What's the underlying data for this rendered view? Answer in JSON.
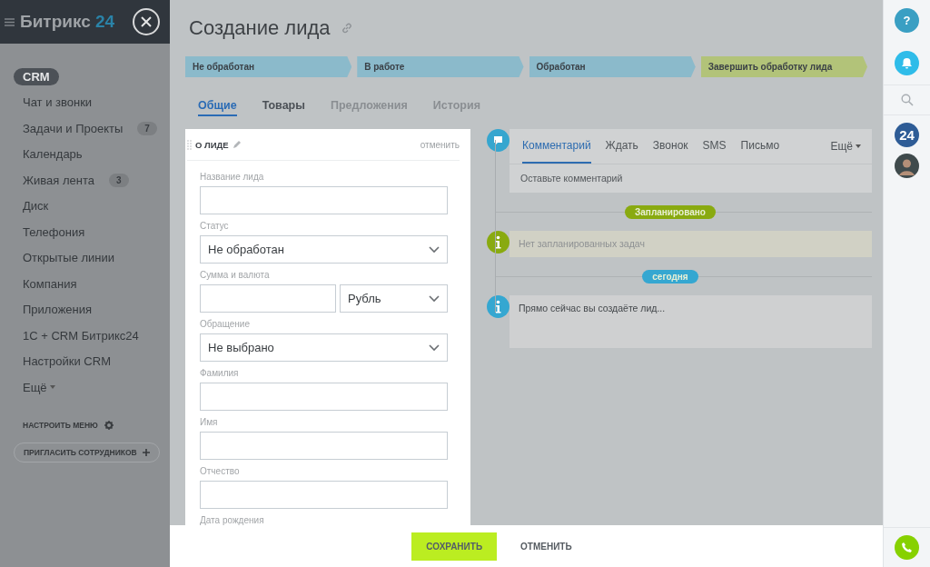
{
  "sidebar": {
    "logo": "Битрикс",
    "logo_accent": "24",
    "items": [
      {
        "label": "CRM",
        "selected": true
      },
      {
        "label": "Чат и звонки",
        "selected": false
      },
      {
        "label": "Задачи и Проекты",
        "counter": "7",
        "selected": false
      },
      {
        "label": "Календарь",
        "selected": false
      },
      {
        "label": "Живая лента",
        "counter": "3",
        "selected": false
      },
      {
        "label": "Диск",
        "selected": false
      },
      {
        "label": "Телефония",
        "selected": false
      },
      {
        "label": "Открытые линии",
        "selected": false
      },
      {
        "label": "Компания",
        "selected": false
      },
      {
        "label": "Приложения",
        "selected": false
      },
      {
        "label": "1С + CRM Битрикс24",
        "selected": false
      },
      {
        "label": "Настройки CRM",
        "selected": false
      },
      {
        "label": "Ещё",
        "kind": "more",
        "selected": false
      }
    ],
    "configure": "НАСТРОИТЬ МЕНЮ",
    "invite": "ПРИГЛАСИТЬ СОТРУДНИКОВ"
  },
  "header": {
    "title": "Создание лида"
  },
  "stages": [
    {
      "label": "Не обработан",
      "color": "#8bbacb"
    },
    {
      "label": "В работе",
      "color": "#8bbacb"
    },
    {
      "label": "Обработан",
      "color": "#8bbacb"
    },
    {
      "label": "Завершить обработку лида",
      "color": "#b2c379"
    }
  ],
  "tabs": [
    {
      "label": "Общие",
      "selected": true,
      "disabled": false
    },
    {
      "label": "Товары",
      "selected": false,
      "disabled": false
    },
    {
      "label": "Предложения",
      "selected": false,
      "disabled": true
    },
    {
      "label": "История",
      "selected": false,
      "disabled": true
    }
  ],
  "form": {
    "title": "О ЛИДЕ",
    "cancel": "отменить",
    "fields": [
      {
        "label": "Название лида",
        "kind": "text"
      },
      {
        "label": "Статус",
        "kind": "select",
        "value": "Не обработан"
      },
      {
        "label": "Сумма и валюта",
        "kind": "money",
        "value": "Рубль"
      },
      {
        "label": "Обращение",
        "kind": "select",
        "value": "Не выбрано"
      },
      {
        "label": "Фамилия",
        "kind": "text"
      },
      {
        "label": "Имя",
        "kind": "text"
      },
      {
        "label": "Отчество",
        "kind": "text"
      },
      {
        "label": "Дата рождения",
        "kind": "label"
      }
    ]
  },
  "timeline": {
    "tabs": [
      {
        "label": "Комментарий",
        "selected": true
      },
      {
        "label": "Ждать",
        "selected": false
      },
      {
        "label": "Звонок",
        "selected": false
      },
      {
        "label": "SMS",
        "selected": false
      },
      {
        "label": "Письмо",
        "selected": false
      }
    ],
    "more": "Ещё",
    "placeholder": "Оставьте комментарий",
    "groups": [
      {
        "badge": "Запланировано",
        "color": "#89aa10",
        "item": {
          "kind": "empty",
          "text": "Нет запланированных задач"
        }
      },
      {
        "badge": "сегодня",
        "color": "#35a7d1",
        "item": {
          "kind": "info",
          "text": "Прямо сейчас вы создаёте лид..."
        }
      }
    ]
  },
  "footer": {
    "buttons": [
      {
        "label": "СОХРАНИТЬ",
        "kind": "primary"
      },
      {
        "label": "ОТМЕНИТЬ",
        "kind": "link"
      }
    ]
  },
  "right_bar": {
    "help": "?",
    "counter": "24"
  }
}
